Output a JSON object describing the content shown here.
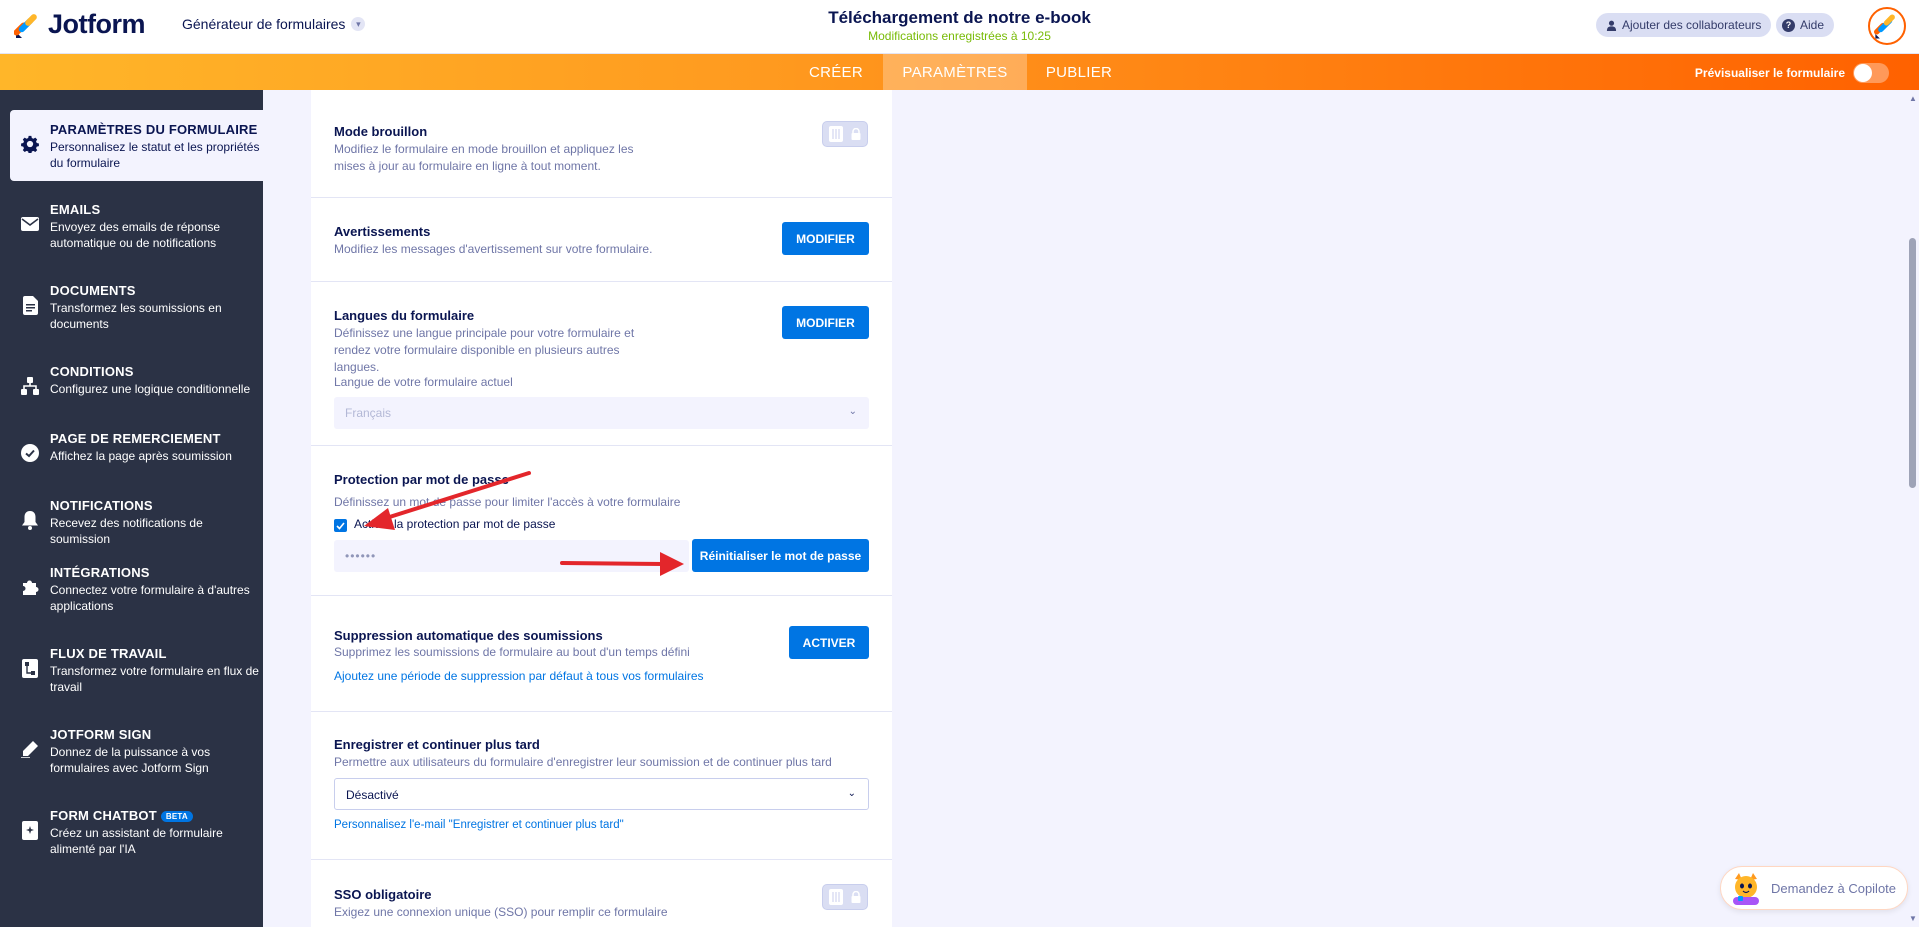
{
  "header": {
    "logo_text": "Jotform",
    "builder_label": "Générateur de formulaires",
    "form_title": "Téléchargement de notre e-book",
    "saved_status": "Modifications enregistrées à 10:25",
    "collaborators_label": "Ajouter des collaborateurs",
    "help_label": "Aide"
  },
  "nav": {
    "tabs": [
      {
        "label": "CRÉER",
        "active": false
      },
      {
        "label": "PARAMÈTRES",
        "active": true
      },
      {
        "label": "PUBLIER",
        "active": false
      }
    ],
    "preview_label": "Prévisualiser le formulaire"
  },
  "sidebar": {
    "items": [
      {
        "title": "PARAMÈTRES DU FORMULAIRE",
        "desc": "Personnalisez le statut et les propriétés du formulaire",
        "icon": "gear-icon",
        "active": true
      },
      {
        "title": "EMAILS",
        "desc": "Envoyez des emails de réponse automatique ou de notifications",
        "icon": "envelope-icon"
      },
      {
        "title": "DOCUMENTS",
        "desc": "Transformez les soumissions en documents",
        "icon": "document-icon"
      },
      {
        "title": "CONDITIONS",
        "desc": "Configurez une logique conditionnelle",
        "icon": "hierarchy-icon"
      },
      {
        "title": "PAGE DE REMERCIEMENT",
        "desc": "Affichez la page après soumission",
        "icon": "check-circle-icon"
      },
      {
        "title": "NOTIFICATIONS",
        "desc": "Recevez des notifications de soumission",
        "icon": "bell-icon"
      },
      {
        "title": "INTÉGRATIONS",
        "desc": "Connectez votre formulaire à d'autres applications",
        "icon": "puzzle-icon"
      },
      {
        "title": "FLUX DE TRAVAIL",
        "desc": "Transformez votre formulaire en flux de travail",
        "icon": "workflow-icon"
      },
      {
        "title": "JOTFORM SIGN",
        "desc": "Donnez de la puissance à vos formulaires avec Jotform Sign",
        "icon": "pen-icon"
      },
      {
        "title": "FORM CHATBOT",
        "desc": "Créez un assistant de formulaire alimenté par l'IA",
        "icon": "chatbot-icon",
        "badge": "BETA"
      }
    ]
  },
  "settings": {
    "draft": {
      "title": "Mode brouillon",
      "desc": "Modifiez le formulaire en mode brouillon et appliquez les mises à jour au formulaire en ligne à tout moment."
    },
    "warnings": {
      "title": "Avertissements",
      "desc": "Modifiez les messages d'avertissement sur votre formulaire.",
      "button": "MODIFIER"
    },
    "languages": {
      "title": "Langues du formulaire",
      "desc": "Définissez une langue principale pour votre formulaire et rendez votre formulaire disponible en plusieurs autres langues.",
      "button": "MODIFIER",
      "field_label": "Langue de votre formulaire actuel",
      "field_value": "Français"
    },
    "password": {
      "title": "Protection par mot de passe",
      "desc": "Définissez un mot de passe pour limiter l'accès à votre formulaire",
      "checkbox_label": "Activer la protection par mot de passe",
      "checked": true,
      "password_mask": "••••••",
      "button": "Réinitialiser le mot de passe"
    },
    "auto_delete": {
      "title": "Suppression automatique des soumissions",
      "desc": "Supprimez les soumissions de formulaire au bout d'un temps défini",
      "button": "ACTIVER",
      "link": "Ajoutez une période de suppression par défaut à tous vos formulaires"
    },
    "save_continue": {
      "title": "Enregistrer et continuer plus tard",
      "desc": "Permettre aux utilisateurs du formulaire d'enregistrer leur soumission et de continuer plus tard",
      "select_value": "Désactivé",
      "link": "Personnalisez l'e-mail \"Enregistrer et continuer plus tard\""
    },
    "sso": {
      "title": "SSO obligatoire",
      "desc": "Exigez une connexion unique (SSO) pour remplir ce formulaire"
    }
  },
  "copilot": {
    "label": "Demandez à Copilote"
  },
  "colors": {
    "accent": "#0075e3",
    "orange": "#ff6100",
    "sidebar_bg": "#2b3245",
    "annotation_red": "#e3262b"
  }
}
